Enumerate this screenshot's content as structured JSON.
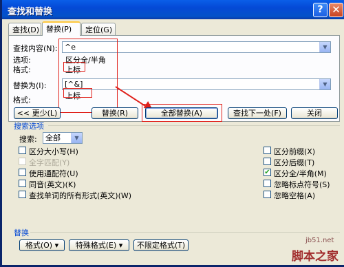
{
  "title": "查找和替换",
  "titlebar_buttons": {
    "help": "?",
    "close": "✕"
  },
  "tabs": [
    {
      "label": "查找(D)",
      "active": false
    },
    {
      "label": "替换(P)",
      "active": true
    },
    {
      "label": "定位(G)",
      "active": false
    }
  ],
  "find": {
    "label": "查找内容(N):",
    "value": "^e",
    "options_label": "选项:",
    "options_value": "区分全/半角",
    "format_label": "格式:",
    "format_value": "上标"
  },
  "replace": {
    "label": "替换为(I):",
    "value": "[^&]",
    "format_label": "格式:",
    "format_value": "上标"
  },
  "buttons": {
    "less": "<< 更少(L)",
    "replace": "替换(R)",
    "replace_all": "全部替换(A)",
    "find_next": "查找下一处(F)",
    "close": "关闭"
  },
  "search_options": {
    "title": "搜索选项",
    "search_label": "搜索:",
    "search_value": "全部",
    "left": [
      {
        "label": "区分大小写(H)",
        "checked": false,
        "disabled": false
      },
      {
        "label": "全字匹配(Y)",
        "checked": false,
        "disabled": true
      },
      {
        "label": "使用通配符(U)",
        "checked": false,
        "disabled": false
      },
      {
        "label": "同音(英文)(K)",
        "checked": false,
        "disabled": false
      },
      {
        "label": "查找单词的所有形式(英文)(W)",
        "checked": false,
        "disabled": false
      }
    ],
    "right": [
      {
        "label": "区分前缀(X)",
        "checked": false
      },
      {
        "label": "区分后缀(T)",
        "checked": false
      },
      {
        "label": "区分全/半角(M)",
        "checked": true
      },
      {
        "label": "忽略标点符号(S)",
        "checked": false
      },
      {
        "label": "忽略空格(A)",
        "checked": false
      }
    ]
  },
  "replace_section": {
    "title": "替换",
    "format": "格式(O) ▾",
    "special": "特殊格式(E) ▾",
    "no_format": "不限定格式(T)"
  },
  "watermark": {
    "site": "jb51.net",
    "brand": "脚本之家"
  },
  "colors": {
    "annotation": "#e0201a",
    "title_bar": "#0449d6",
    "group_title": "#0046d5"
  }
}
